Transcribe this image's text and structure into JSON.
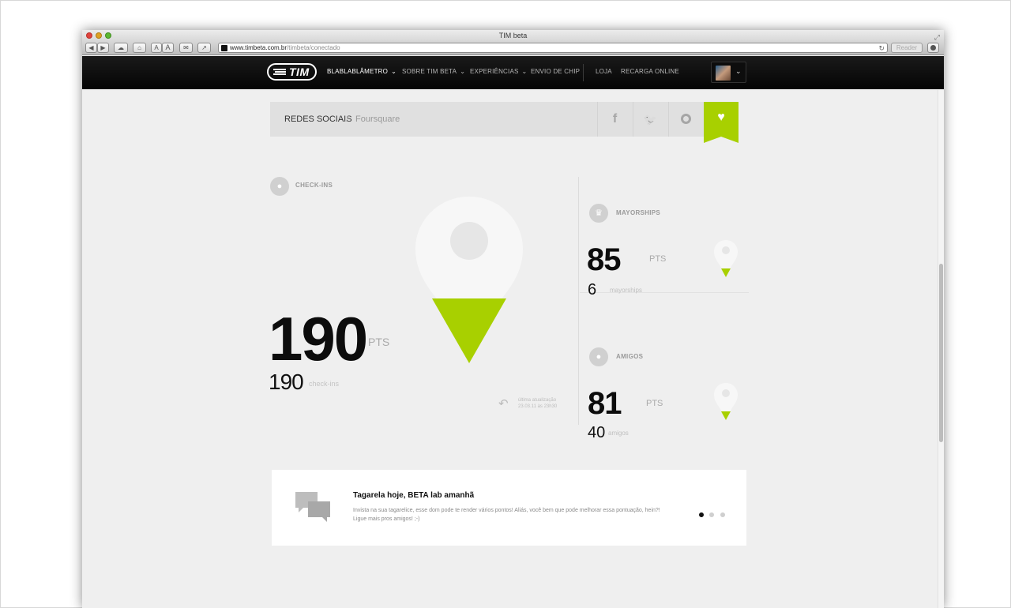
{
  "window": {
    "title": "TIM beta"
  },
  "toolbar": {
    "url_host": "www.timbeta.com.br",
    "url_path": "/timbeta/conectado",
    "reader_label": "Reader",
    "back_label": "◀",
    "forward_label": "▶",
    "text_small_label": "A",
    "text_large_label": "A"
  },
  "nav": {
    "logo_text": "TIM",
    "items": [
      {
        "label": "BLABLABLÂMETRO",
        "chevron": "⌄"
      },
      {
        "label": "SOBRE TIM BETA",
        "chevron": "⌄"
      },
      {
        "label": "EXPERIÊNCIAS",
        "chevron": "⌄"
      },
      {
        "label": "ENVIO DE CHIP"
      },
      {
        "label": "LOJA"
      },
      {
        "label": "RECARGA ONLINE"
      }
    ],
    "avatar_chevron": "⌄"
  },
  "breadcrumb": {
    "main": "REDES SOCIAIS",
    "separator": "/",
    "sub": "Foursquare"
  },
  "social_tabs": [
    {
      "name": "facebook",
      "glyph": "f"
    },
    {
      "name": "twitter",
      "glyph": "🐦"
    },
    {
      "name": "orkut",
      "glyph": ""
    },
    {
      "name": "foursquare",
      "glyph": "♥",
      "active": true
    }
  ],
  "checkins": {
    "label": "CHECK-INS",
    "points": "190",
    "points_unit": "PTS",
    "count": "190",
    "count_label": "check-ins",
    "update_line1": "última atualização",
    "update_line2": "23.03.11 às 23h30"
  },
  "mayorships": {
    "label": "MAYORSHIPS",
    "points": "85",
    "points_unit": "PTS",
    "count": "6",
    "count_label": "mayorships"
  },
  "friends": {
    "label": "AMIGOS",
    "points": "81",
    "points_unit": "PTS",
    "count": "40",
    "count_label": "amigos"
  },
  "banner": {
    "title": "Tagarela hoje, BETA lab amanhã",
    "text": "Invista na sua tagarelice, esse dom pode te render vários pontos! Aliás, você bem que pode melhorar essa pontuação, hein?! Ligue mais pros amigos! ;-)",
    "active_dot": 1,
    "dot_count": 3
  },
  "colors": {
    "accent": "#a8d000",
    "nav_bg": "#0a0a0a",
    "page_bg": "#efefef"
  },
  "icons": {
    "checkins": "map-pin-icon",
    "mayorships": "crown-icon",
    "friends": "user-icon",
    "banner": "chat-bubbles-icon"
  }
}
